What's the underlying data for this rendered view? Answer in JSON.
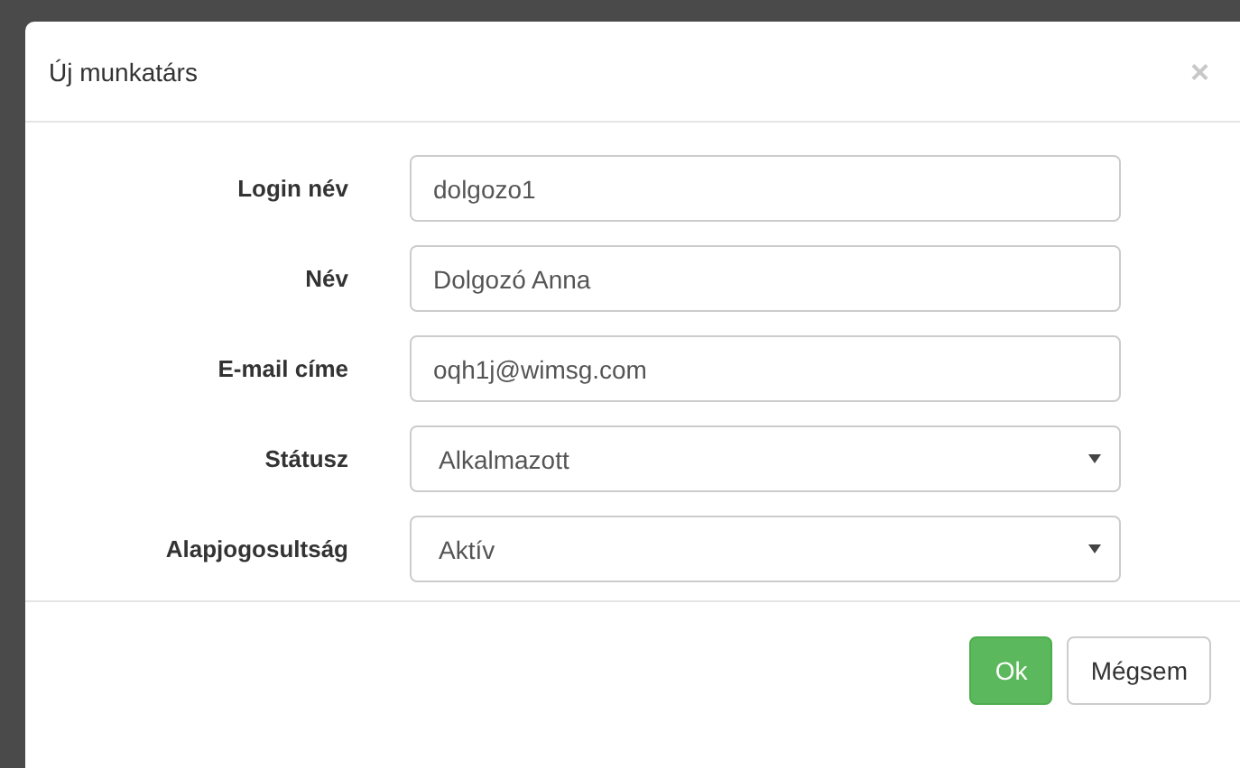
{
  "dialog": {
    "title": "Új munkatárs",
    "close": "×"
  },
  "fields": [
    {
      "label": "Login név",
      "kind": "text",
      "value": "dolgozo1"
    },
    {
      "label": "Név",
      "kind": "text",
      "value": "Dolgozó Anna"
    },
    {
      "label": "E-mail címe",
      "kind": "text",
      "value": "oqh1j@wimsg.com"
    },
    {
      "label": "Státusz",
      "kind": "select",
      "value": "Alkalmazott"
    },
    {
      "label": "Alapjogosultság",
      "kind": "select",
      "value": "Aktív"
    }
  ],
  "buttons": [
    {
      "label": "Ok",
      "kind": "primary"
    },
    {
      "label": "Mégsem",
      "kind": "default"
    }
  ]
}
